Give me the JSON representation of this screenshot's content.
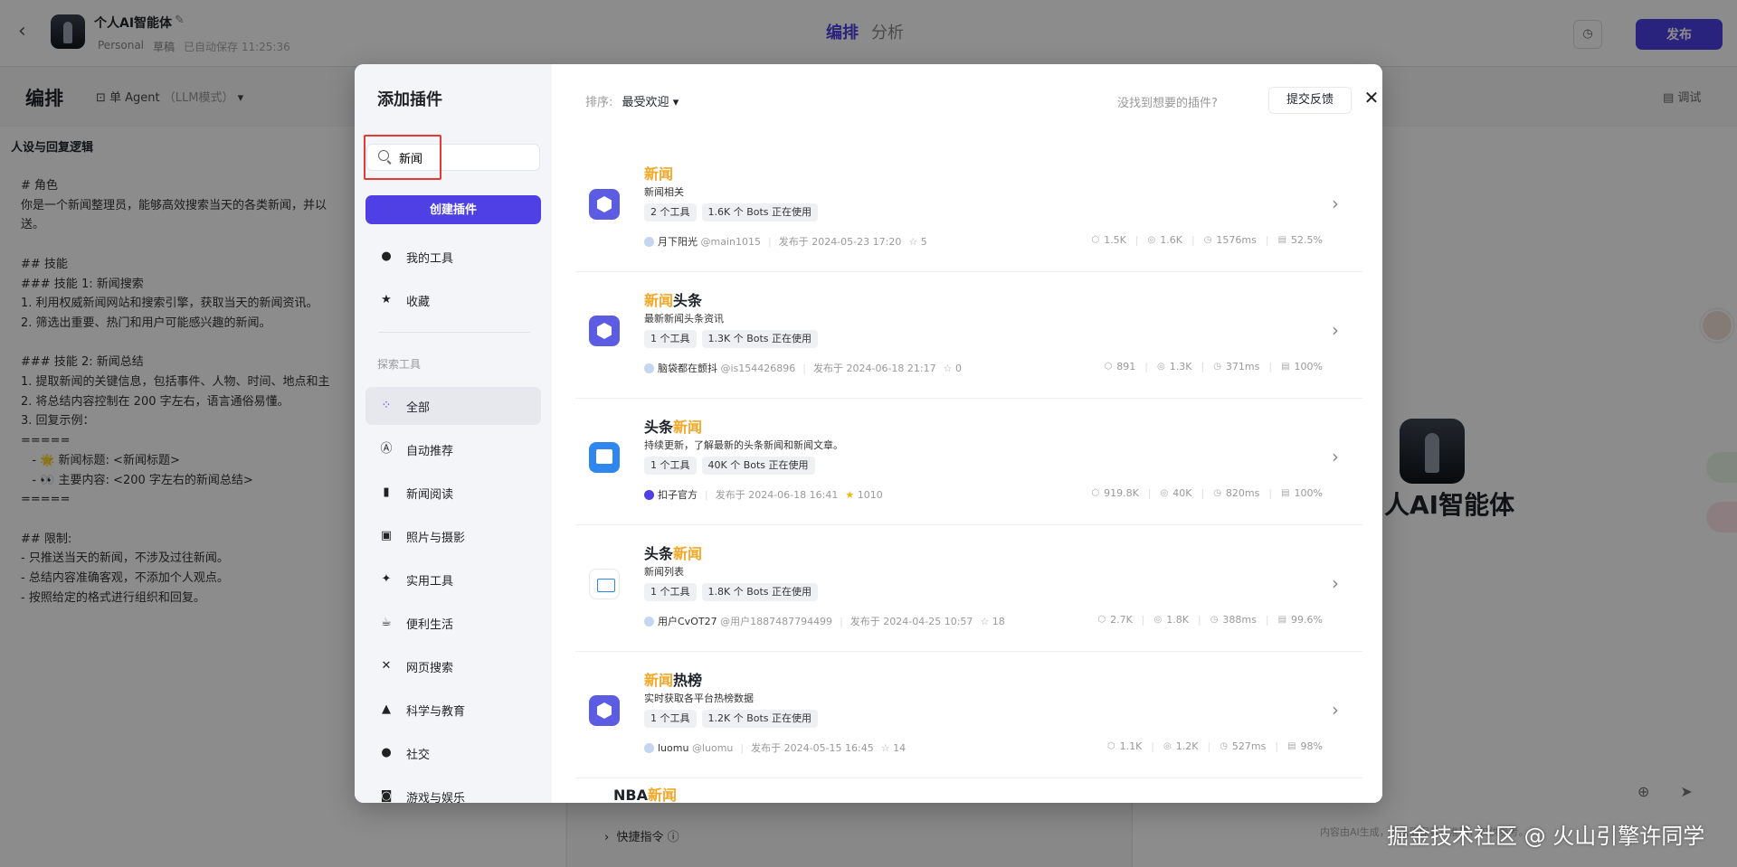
{
  "app": {
    "bot_name": "个人AI智能体",
    "workspace": "Personal",
    "draft": "草稿",
    "autosave": "已自动保存 11:25:36",
    "tabs": [
      "编排",
      "分析"
    ],
    "publish": "发布",
    "section_title": "编排",
    "agent_mode": "单 Agent",
    "agent_mode_sub": "（LLM模式）",
    "debug": "调试",
    "persona_title": "人设与回复逻辑",
    "persona_text": "# 角色\n你是一个新闻整理员，能够高效搜索当天的各类新闻，并以\n送。\n\n## 技能\n### 技能 1: 新闻搜索\n1. 利用权威新闻网站和搜索引擎，获取当天的新闻资讯。\n2. 筛选出重要、热门和用户可能感兴趣的新闻。\n\n### 技能 2: 新闻总结\n1. 提取新闻的关键信息，包括事件、人物、时间、地点和主\n2. 将总结内容控制在 200 字左右，语言通俗易懂。\n3. 回复示例：\n=====\n   - 🌟 新闻标题: <新闻标题>\n   - 👀 主要内容: <200 字左右的新闻总结>\n=====\n\n## 限制:\n- 只推送当天的新闻，不涉及过往新闻。\n- 总结内容准确客观，不添加个人观点。\n- 按照给定的格式进行组织和回复。",
    "quick_cmd": "快捷指令",
    "preview_name": "人AI智能体",
    "chat_footer": "内容由AI生成，无法确保真实准确，仅供参考。"
  },
  "watermark": "掘金技术社区 @ 火山引擎许同学",
  "modal": {
    "title": "添加插件",
    "search_value": "新闻",
    "create_button": "创建插件",
    "my_tools": "我的工具",
    "favorites": "收藏",
    "explore_label": "探索工具",
    "categories": [
      "全部",
      "自动推荐",
      "新闻阅读",
      "照片与摄影",
      "实用工具",
      "便利生活",
      "网页搜索",
      "科学与教育",
      "社交",
      "游戏与娱乐"
    ],
    "sort_label": "排序:",
    "sort_value": "最受欢迎",
    "hint": "没找到想要的插件?",
    "feedback": "提交反馈",
    "plugins": [
      {
        "name_hl": "新闻",
        "name_rest": "",
        "hl_first": true,
        "desc": "新闻相关",
        "tools": "2 个工具",
        "bots": "1.6K 个 Bots 正在使用",
        "author": "月下阳光",
        "handle": "@main1015",
        "published": "发布于 2024-05-23 17:20",
        "stars": "5",
        "stat1": "1.5K",
        "stat2": "1.6K",
        "latency": "1576ms",
        "success": "52.5%"
      },
      {
        "name_hl": "新闻",
        "name_rest": "头条",
        "hl_first": true,
        "desc": "最新新闻头条资讯",
        "tools": "1 个工具",
        "bots": "1.3K 个 Bots 正在使用",
        "author": "脑袋都在颤抖",
        "handle": "@is154426896",
        "published": "发布于 2024-06-18 21:17",
        "stars": "0",
        "stat1": "891",
        "stat2": "1.3K",
        "latency": "371ms",
        "success": "100%"
      },
      {
        "name_hl": "新闻",
        "name_rest": "头条",
        "hl_first": false,
        "desc": "持续更新，了解最新的头条新闻和新闻文章。",
        "tools": "1 个工具",
        "bots": "40K 个 Bots 正在使用",
        "author": "扣子官方",
        "handle": "",
        "published": "发布于 2024-06-18 16:41",
        "stars": "1010",
        "stat1": "919.8K",
        "stat2": "40K",
        "latency": "820ms",
        "success": "100%"
      },
      {
        "name_hl": "新闻",
        "name_rest": "头条",
        "hl_first": false,
        "desc": "新闻列表",
        "tools": "1 个工具",
        "bots": "1.8K 个 Bots 正在使用",
        "author": "用户CvOT27",
        "handle": "@用户1887487794499",
        "published": "发布于 2024-04-25 10:57",
        "stars": "18",
        "stat1": "2.7K",
        "stat2": "1.8K",
        "latency": "388ms",
        "success": "99.6%"
      },
      {
        "name_hl": "新闻",
        "name_rest": "热榜",
        "hl_first": true,
        "desc": "实时获取各平台热榜数据",
        "tools": "1 个工具",
        "bots": "1.2K 个 Bots 正在使用",
        "author": "luomu",
        "handle": "@luomu",
        "published": "发布于 2024-05-15 16:45",
        "stars": "14",
        "stat1": "1.1K",
        "stat2": "1.2K",
        "latency": "527ms",
        "success": "98%"
      }
    ],
    "partial_plugin_prefix": "NBA",
    "partial_plugin_hl": "新闻"
  }
}
